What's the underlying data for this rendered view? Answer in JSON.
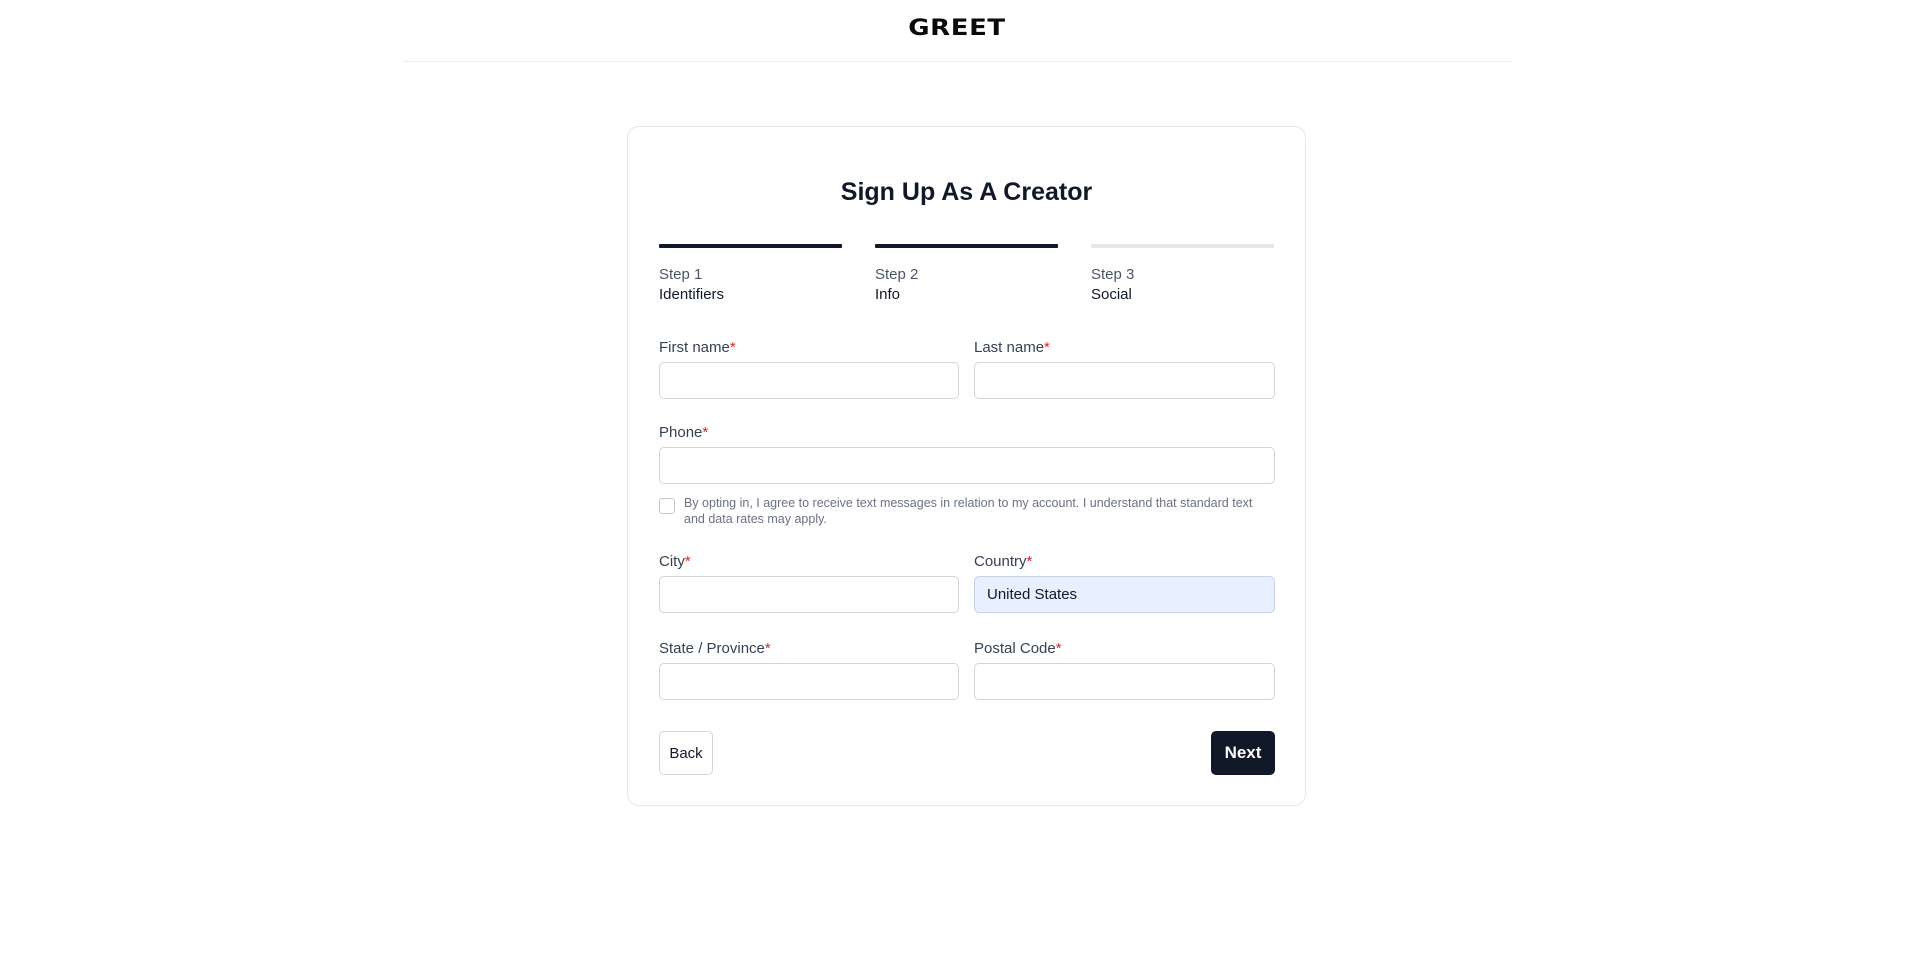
{
  "header": {
    "logo": "GREET"
  },
  "form": {
    "title": "Sign Up As A Creator",
    "steps": [
      {
        "number": "Step 1",
        "name": "Identifiers",
        "active": true
      },
      {
        "number": "Step 2",
        "name": "Info",
        "active": true
      },
      {
        "number": "Step 3",
        "name": "Social",
        "active": false
      }
    ],
    "fields": {
      "first_name": {
        "label": "First name",
        "required": "*",
        "value": ""
      },
      "last_name": {
        "label": "Last name",
        "required": "*",
        "value": ""
      },
      "phone": {
        "label": "Phone",
        "required": "*",
        "value": ""
      },
      "city": {
        "label": "City",
        "required": "*",
        "value": ""
      },
      "country": {
        "label": "Country",
        "required": "*",
        "value": "United States"
      },
      "state": {
        "label": "State / Province",
        "required": "*",
        "value": ""
      },
      "postal_code": {
        "label": "Postal Code",
        "required": "*",
        "value": ""
      }
    },
    "optin_text": "By opting in, I agree to receive text messages in relation to my account. I understand that standard text and data rates may apply.",
    "optin_checked": false,
    "back_label": "Back",
    "next_label": "Next"
  },
  "colors": {
    "primary": "#111827",
    "required": "#dc2626",
    "autofill": "#e8f0fe"
  }
}
